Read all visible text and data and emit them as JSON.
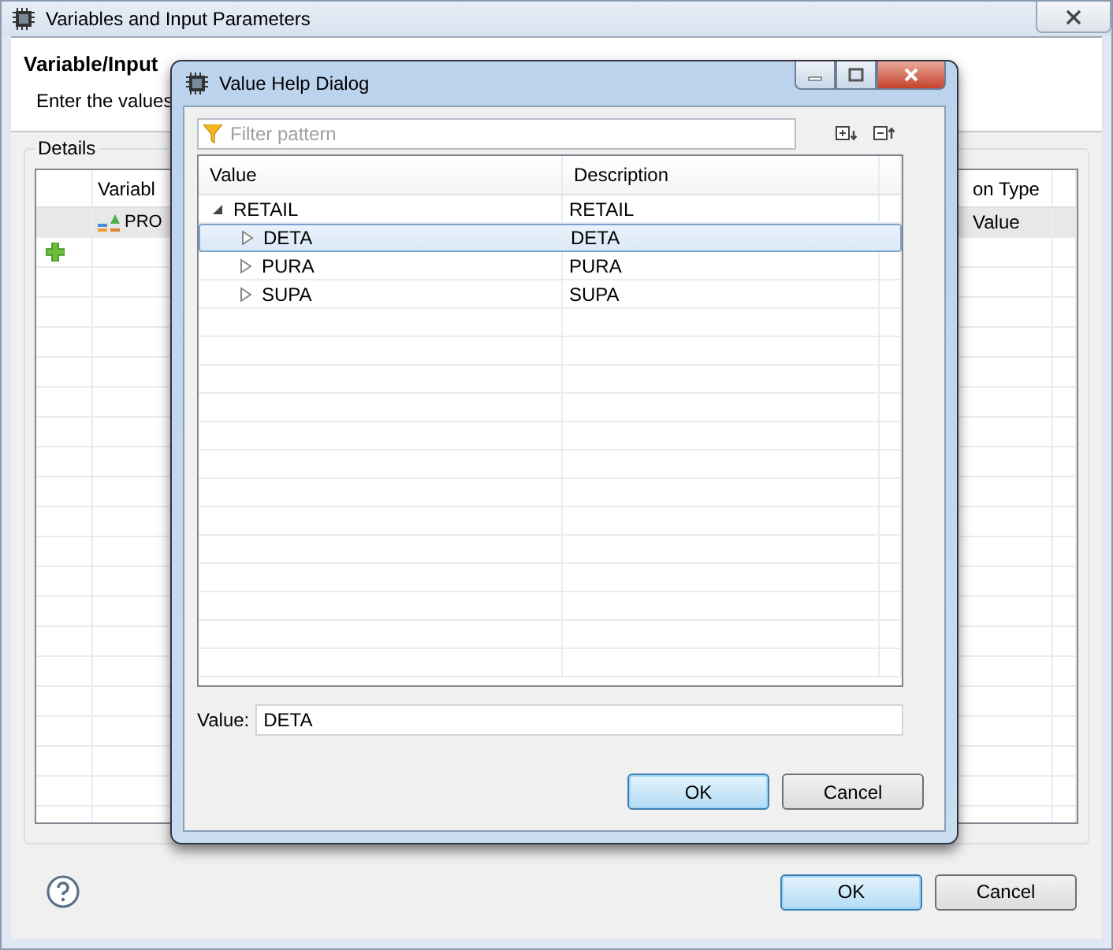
{
  "window": {
    "title": "Variables and Input Parameters"
  },
  "heading": "Variable/Input",
  "description": "Enter the values",
  "details": {
    "title": "Details",
    "columns": [
      "Variabl",
      "on Type"
    ],
    "rows": [
      {
        "column_1": "PRO",
        "column_2": "Value"
      }
    ]
  },
  "buttons": [
    {
      "label": "OK",
      "default": true
    },
    {
      "label": "Cancel",
      "default": false
    }
  ],
  "dialog": {
    "title": "Value Help Dialog",
    "filter": {
      "placeholder": "Filter pattern"
    },
    "columns": [
      "Value",
      "Description"
    ],
    "tree": [
      {
        "value": "RETAIL",
        "description": "RETAIL",
        "expanded": true,
        "selected": false,
        "children": [
          {
            "value": "DETA",
            "description": "DETA",
            "expanded": false,
            "selected": true
          },
          {
            "value": "PURA",
            "description": "PURA",
            "expanded": false,
            "selected": false
          },
          {
            "value": "SUPA",
            "description": "SUPA",
            "expanded": false,
            "selected": false
          }
        ]
      }
    ],
    "value_label": "Value:",
    "value": "DETA",
    "buttons": [
      {
        "label": "OK",
        "default": true
      },
      {
        "label": "Cancel",
        "default": false
      }
    ]
  }
}
